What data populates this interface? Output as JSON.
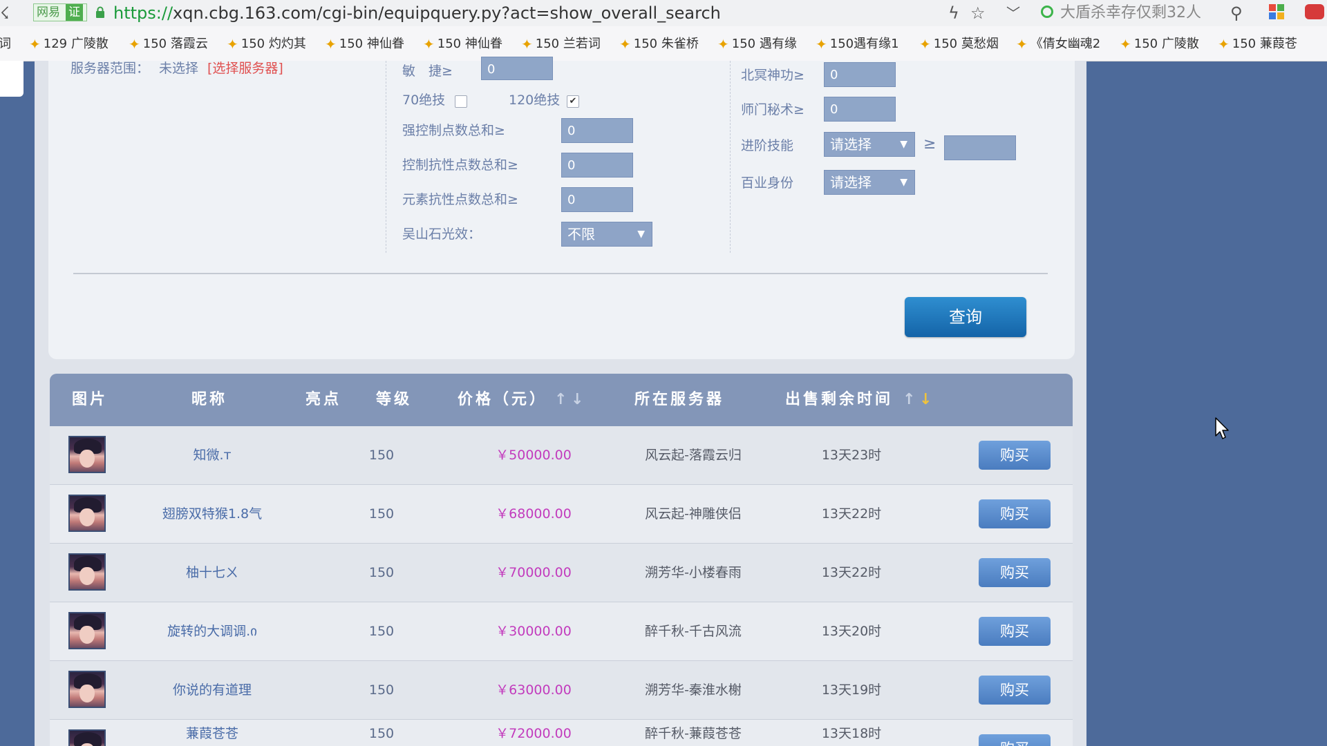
{
  "browser": {
    "site_badge": "网易",
    "cert_badge": "证",
    "url_scheme": "https://",
    "url_rest": "xqn.cbg.163.com/cgi-bin/equipquery.py?act=show_overall_search",
    "search_placeholder": "大盾杀幸存仅剩32人",
    "bookmarks": [
      "词",
      "129 广陵散",
      "150 落霞云",
      "150 灼灼其",
      "150 神仙眷",
      "150 神仙眷",
      "150 兰若词",
      "150 朱雀桥",
      "150 遇有缘",
      "150遇有缘1",
      "150 莫愁烟",
      "《倩女幽魂2",
      "150 广陵散",
      "150 蒹葭苍"
    ]
  },
  "filters": {
    "server_range_label": "服务器范围：",
    "server_range_value": "未选择",
    "server_select_link": "[选择服务器]",
    "agility_label": "敏　捷≥",
    "agility_value": "0",
    "skill70_label": "70绝技",
    "skill70_checked": false,
    "skill120_label": "120绝技",
    "skill120_checked": true,
    "strong_control_label": "强控制点数总和≥",
    "strong_control_value": "0",
    "control_resist_label": "控制抗性点数总和≥",
    "control_resist_value": "0",
    "element_resist_label": "元素抗性点数总和≥",
    "element_resist_value": "0",
    "wushan_label": "吴山石光效：",
    "wushan_value": "不限",
    "beiming_label": "北冥神功≥",
    "beiming_value": "0",
    "shimen_label": "师门秘术≥",
    "shimen_value": "0",
    "advanced_skill_label": "进阶技能",
    "advanced_skill_value": "请选择",
    "advanced_skill_ge": "≥",
    "advanced_skill_input": "",
    "profession_label": "百业身份",
    "profession_value": "请选择",
    "query_button": "查询"
  },
  "table": {
    "headers": {
      "image": "图片",
      "nickname": "昵称",
      "highlight": "亮点",
      "level": "等级",
      "price": "价格（元）",
      "server": "所在服务器",
      "time_left": "出售剩余时间"
    },
    "buy_label": "购买",
    "rows": [
      {
        "nickname": "知微.т",
        "level": "150",
        "price": "￥50000.00",
        "server": "风云起-落霞云归",
        "time_left": "13天23时"
      },
      {
        "nickname": "翅膀双特猴1.8气",
        "level": "150",
        "price": "￥68000.00",
        "server": "风云起-神雕侠侣",
        "time_left": "13天22时"
      },
      {
        "nickname": "柚十七ㄨ",
        "level": "150",
        "price": "￥70000.00",
        "server": "溯芳华-小楼春雨",
        "time_left": "13天22时"
      },
      {
        "nickname": "旋转的大调调.ი",
        "level": "150",
        "price": "￥30000.00",
        "server": "醉千秋-千古风流",
        "time_left": "13天20时"
      },
      {
        "nickname": "你说的有道理",
        "level": "150",
        "price": "￥63000.00",
        "server": "溯芳华-秦淮水榭",
        "time_left": "13天19时"
      },
      {
        "nickname": "蒹葭苍苍",
        "level": "150",
        "price": "￥72000.00",
        "server": "醉千秋-蒹葭苍苍",
        "time_left": "13天18时"
      }
    ]
  }
}
